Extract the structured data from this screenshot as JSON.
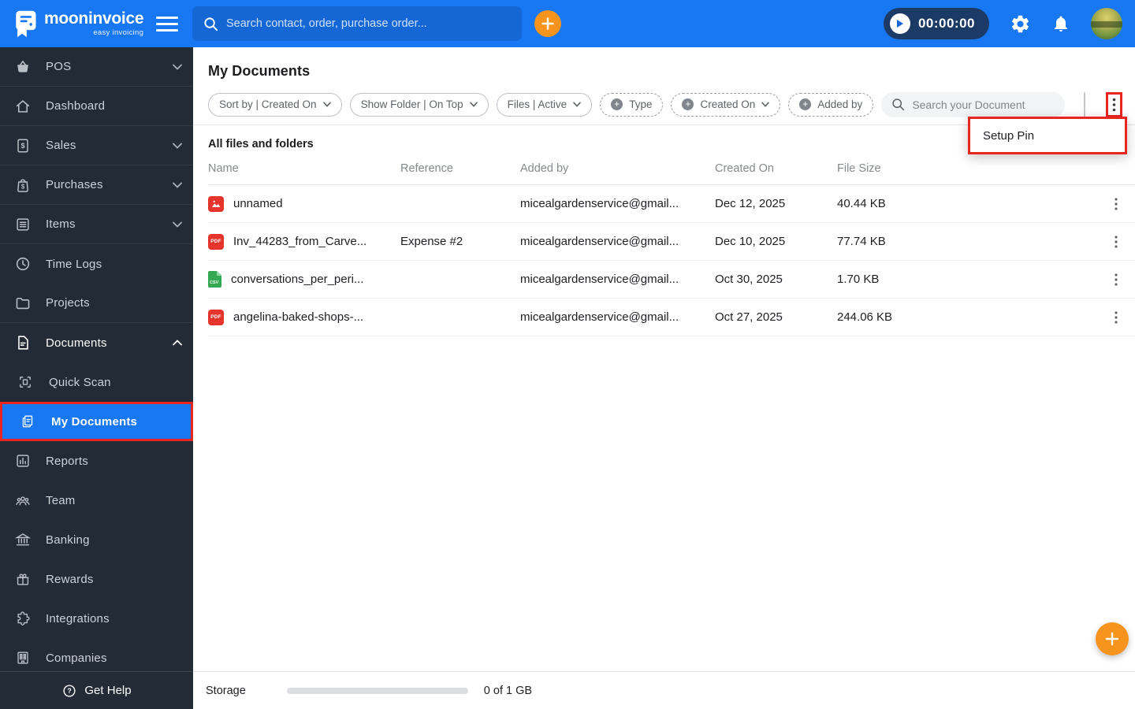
{
  "topbar": {
    "brand": {
      "name": "mooninvoice",
      "tagline": "easy invoicing"
    },
    "search_placeholder": "Search contact, order, purchase order...",
    "timer": "00:00:00"
  },
  "sidebar": {
    "items": [
      {
        "label": "POS"
      },
      {
        "label": "Dashboard"
      },
      {
        "label": "Sales"
      },
      {
        "label": "Purchases"
      },
      {
        "label": "Items"
      },
      {
        "label": "Time Logs"
      },
      {
        "label": "Projects"
      },
      {
        "label": "Documents"
      },
      {
        "label": "Quick Scan"
      },
      {
        "label": "My Documents"
      },
      {
        "label": "Reports"
      },
      {
        "label": "Team"
      },
      {
        "label": "Banking"
      },
      {
        "label": "Rewards"
      },
      {
        "label": "Integrations"
      },
      {
        "label": "Companies"
      }
    ],
    "get_help": "Get Help"
  },
  "main": {
    "title": "My Documents",
    "filters": {
      "sort_by": "Sort by | Created On",
      "show_folder": "Show Folder | On Top",
      "files": "Files | Active",
      "type": "Type",
      "created_on": "Created On",
      "added_by": "Added by"
    },
    "search_placeholder": "Search your Document",
    "menu": {
      "setup_pin": "Setup Pin"
    },
    "section_title": "All files and folders",
    "table": {
      "columns": [
        "Name",
        "Reference",
        "Added by",
        "Created On",
        "File Size"
      ],
      "rows": [
        {
          "type": "image",
          "name": "unnamed",
          "reference": "",
          "added_by": "micealgardenservice@gmail...",
          "created_on": "Dec 12, 2025",
          "file_size": "40.44 KB"
        },
        {
          "type": "pdf",
          "name": "Inv_44283_from_Carve...",
          "reference": "Expense #2",
          "added_by": "micealgardenservice@gmail...",
          "created_on": "Dec 10, 2025",
          "file_size": "77.74 KB"
        },
        {
          "type": "csv",
          "name": "conversations_per_peri...",
          "reference": "",
          "added_by": "micealgardenservice@gmail...",
          "created_on": "Oct 30, 2025",
          "file_size": "1.70 KB"
        },
        {
          "type": "pdf",
          "name": "angelina-baked-shops-...",
          "reference": "",
          "added_by": "micealgardenservice@gmail...",
          "created_on": "Oct 27, 2025",
          "file_size": "244.06 KB"
        }
      ]
    },
    "storage": {
      "label": "Storage",
      "value": "0 of 1 GB",
      "percent": 0
    }
  },
  "icons": {
    "pdf_label": "PDF",
    "csv_label": "CSV"
  },
  "colors": {
    "accent": "#1877F2",
    "red": "#E8251F",
    "orange": "#F7941E",
    "sidebar_bg": "#232B36",
    "file_red": "#E5342C",
    "file_green": "#34A853"
  }
}
